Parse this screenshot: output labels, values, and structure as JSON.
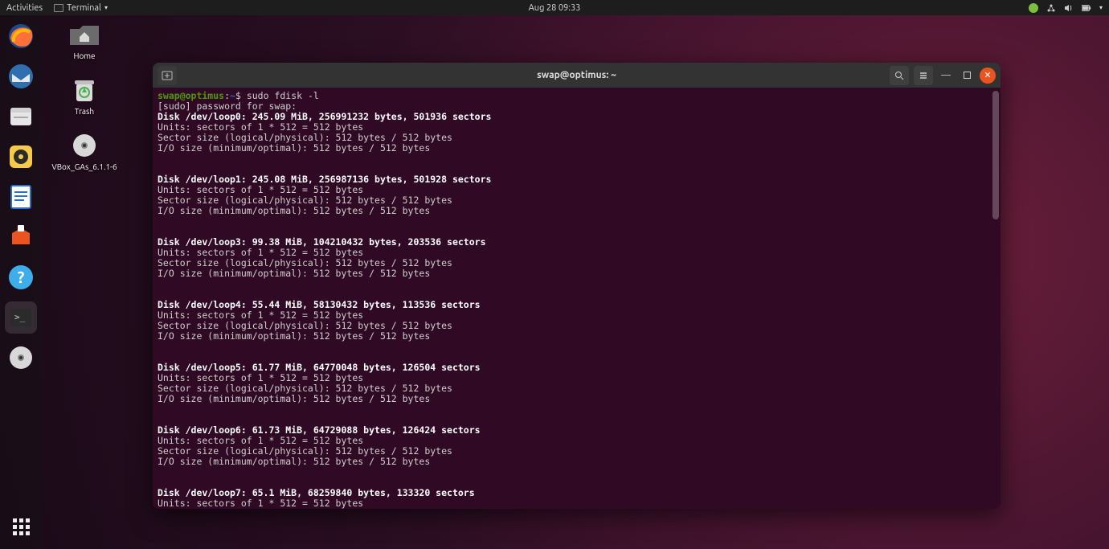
{
  "topbar": {
    "activities": "Activities",
    "appname": "Terminal",
    "datetime": "Aug 28  09:33"
  },
  "desktop": {
    "home": "Home",
    "trash": "Trash",
    "vbox": "VBox_GAs_6.1.1-6"
  },
  "terminal": {
    "title": "swap@optimus: ~",
    "prompt_user": "swap@optimus",
    "prompt_colon": ":",
    "prompt_path": "~",
    "prompt_dollar": "$",
    "command": " sudo fdisk -l",
    "sudo_line": "[sudo] password for swap:",
    "common": {
      "units": "Units: sectors of 1 * 512 = 512 bytes",
      "sector": "Sector size (logical/physical): 512 bytes / 512 bytes",
      "io": "I/O size (minimum/optimal): 512 bytes / 512 bytes"
    },
    "disks": [
      {
        "header": "Disk /dev/loop0: 245.09 MiB, 256991232 bytes, 501936 sectors"
      },
      {
        "header": "Disk /dev/loop1: 245.08 MiB, 256987136 bytes, 501928 sectors"
      },
      {
        "header": "Disk /dev/loop3: 99.38 MiB, 104210432 bytes, 203536 sectors"
      },
      {
        "header": "Disk /dev/loop4: 55.44 MiB, 58130432 bytes, 113536 sectors"
      },
      {
        "header": "Disk /dev/loop5: 61.77 MiB, 64770048 bytes, 126504 sectors"
      },
      {
        "header": "Disk /dev/loop6: 61.73 MiB, 64729088 bytes, 126424 sectors"
      },
      {
        "header": "Disk /dev/loop7: 65.1 MiB, 68259840 bytes, 133320 sectors"
      }
    ]
  }
}
